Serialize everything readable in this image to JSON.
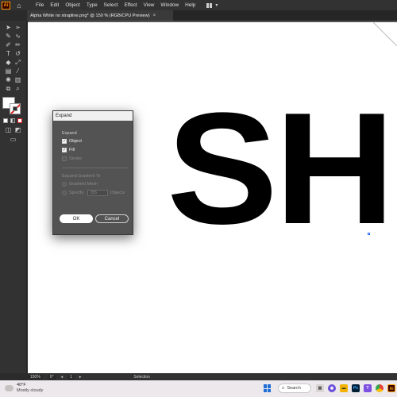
{
  "app": {
    "logo_text": "Ai",
    "menu": [
      "File",
      "Edit",
      "Object",
      "Type",
      "Select",
      "Effect",
      "View",
      "Window",
      "Help"
    ]
  },
  "tab": {
    "title": "Alpha White no strapline.png* @ 150 % (RGB/CPU Preview)",
    "close": "×"
  },
  "artwork": {
    "text": "SH"
  },
  "dialog": {
    "title": "Expand",
    "expand_label": "Expand",
    "options": [
      {
        "label": "Object",
        "checked": true,
        "enabled": true
      },
      {
        "label": "Fill",
        "checked": true,
        "enabled": true
      },
      {
        "label": "Stroke",
        "checked": false,
        "enabled": false
      }
    ],
    "gradient_label": "Expand Gradient To",
    "gradient_mesh": "Gradient Mesh",
    "specify": "Specify:",
    "specify_value": "255",
    "objects_suffix": "Objects",
    "ok": "OK",
    "cancel": "Cancel"
  },
  "status": {
    "zoom": "150%",
    "angle": "0°",
    "artboard": "1",
    "tool": "Selection"
  },
  "taskbar": {
    "temperature": "40°F",
    "weather": "Mostly cloudy",
    "search_label": "Search"
  },
  "colors": {
    "accent": "#ff9a00",
    "windows_blue": "#1f6fd6"
  }
}
